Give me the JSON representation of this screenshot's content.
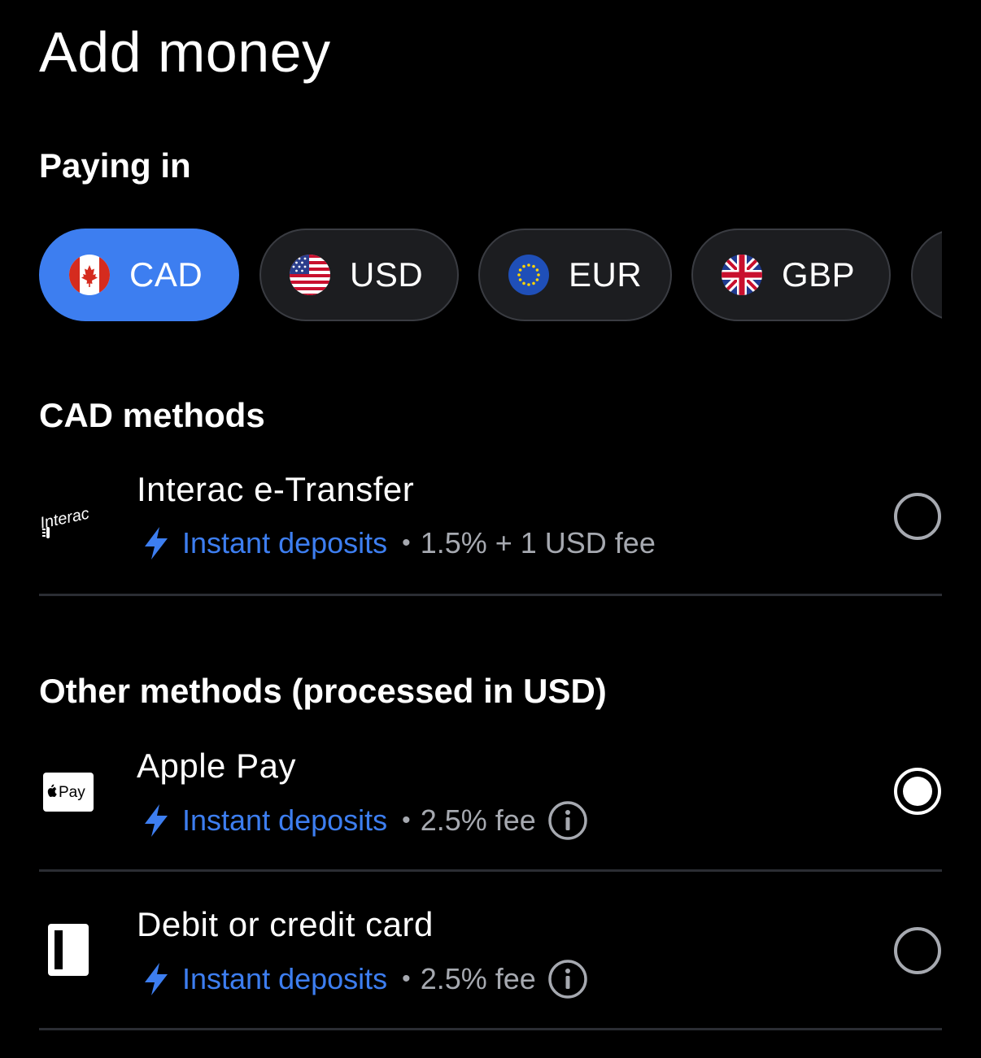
{
  "page": {
    "title": "Add money"
  },
  "paying_in": {
    "heading": "Paying in",
    "currencies": [
      {
        "code": "CAD",
        "icon": "canada-flag-icon",
        "selected": true
      },
      {
        "code": "USD",
        "icon": "us-flag-icon",
        "selected": false
      },
      {
        "code": "EUR",
        "icon": "eu-flag-icon",
        "selected": false
      },
      {
        "code": "GBP",
        "icon": "uk-flag-icon",
        "selected": false
      }
    ]
  },
  "cad_methods": {
    "heading": "CAD methods",
    "items": [
      {
        "name": "Interac e-Transfer",
        "logo": "interac-logo",
        "logo_text": "Interac",
        "speed": "Instant deposits",
        "fee": "1.5% + 1 USD fee",
        "has_info": false,
        "selected": false
      }
    ]
  },
  "other_methods": {
    "heading": "Other methods (processed in USD)",
    "items": [
      {
        "name": "Apple Pay",
        "logo": "apple-pay-logo",
        "logo_text": "Pay",
        "speed": "Instant deposits",
        "fee": "2.5% fee",
        "has_info": true,
        "selected": true
      },
      {
        "name": "Debit or credit card",
        "logo": "card-icon",
        "speed": "Instant deposits",
        "fee": "2.5% fee",
        "has_info": true,
        "selected": false
      }
    ]
  },
  "colors": {
    "background": "#000000",
    "accent": "#3d7ef0",
    "chip_background": "#1c1d20",
    "muted_text": "#a6a9b0",
    "divider": "#2b2d33"
  }
}
